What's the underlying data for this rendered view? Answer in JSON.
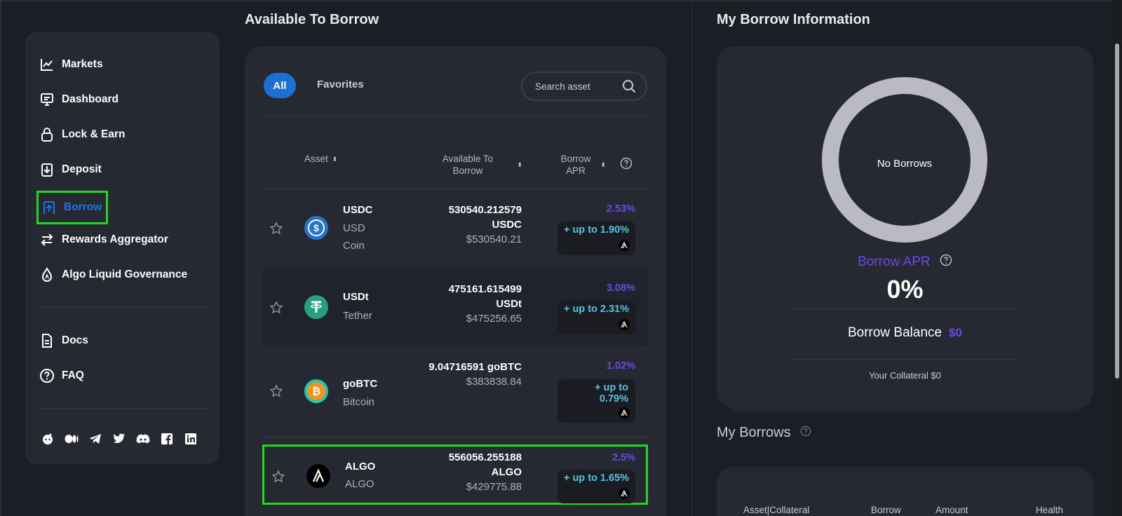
{
  "sidebar": {
    "nav": [
      {
        "label": "Markets",
        "icon": "chart-line-icon"
      },
      {
        "label": "Dashboard",
        "icon": "monitor-icon"
      },
      {
        "label": "Lock & Earn",
        "icon": "lock-icon"
      },
      {
        "label": "Deposit",
        "icon": "deposit-icon"
      },
      {
        "label": "Borrow",
        "icon": "borrow-icon",
        "active": true
      },
      {
        "label": "Rewards Aggregator",
        "icon": "swap-arrows-icon"
      },
      {
        "label": "Algo Liquid Governance",
        "icon": "droplet-icon"
      }
    ],
    "secondary": [
      {
        "label": "Docs",
        "icon": "document-icon"
      },
      {
        "label": "FAQ",
        "icon": "question-circle-icon"
      }
    ],
    "social_icons": [
      "reddit-icon",
      "medium-icon",
      "telegram-icon",
      "twitter-icon",
      "discord-icon",
      "facebook-icon",
      "linkedin-icon"
    ]
  },
  "available": {
    "title": "Available To Borrow",
    "tabs": {
      "all": "All",
      "favorites": "Favorites"
    },
    "search": {
      "placeholder": "Search asset"
    },
    "columns": {
      "asset": "Asset",
      "available_l1": "Available To",
      "available_l2": "Borrow",
      "apr_l1": "Borrow",
      "apr_l2": "APR"
    },
    "rows": [
      {
        "symbol": "USDC",
        "name_l1": "USD",
        "name_l2": "Coin",
        "amount_l1": "530540.212579",
        "amount_l2": "USDC",
        "usd": "$530540.21",
        "apr": "2.53%",
        "boost": "+ up to 1.90%"
      },
      {
        "symbol": "USDt",
        "name_l1": "Tether",
        "amount_l1": "475161.615499",
        "amount_l2": "USDt",
        "usd": "$475256.65",
        "apr": "3.08%",
        "boost": "+ up to 2.31%"
      },
      {
        "symbol": "goBTC",
        "name_l1": "Bitcoin",
        "amount_l1": "9.04716591 goBTC",
        "usd": "$383838.84",
        "apr": "1.02%",
        "boost_l1": "+ up to",
        "boost_l2": "0.79%"
      },
      {
        "symbol": "ALGO",
        "name_l1": "ALGO",
        "amount_l1": "556056.255188",
        "amount_l2": "ALGO",
        "usd": "$429775.88",
        "apr": "2.5%",
        "boost": "+ up to 1.65%"
      }
    ]
  },
  "info": {
    "title": "My Borrow Information",
    "donut_label": "No Borrows",
    "apr_label": "Borrow APR",
    "apr_value": "0%",
    "balance_label": "Borrow Balance",
    "balance_value": "$0",
    "collateral": "Your Collateral $0"
  },
  "my_borrows": {
    "title": "My Borrows",
    "columns": {
      "asset": "Asset|Collateral",
      "borrow": "Borrow",
      "amount": "Amount",
      "health": "Health"
    }
  },
  "colors": {
    "accent_blue": "#1d6fd4",
    "accent_purple": "#6b48e6",
    "boost_cyan": "#4fc4e3",
    "highlight_green": "#22d81e"
  }
}
